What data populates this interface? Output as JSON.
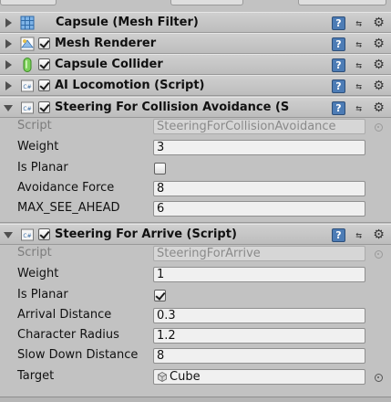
{
  "components": [
    {
      "title": "Capsule (Mesh Filter)",
      "icon": "mesh-filter-icon",
      "has_checkbox": false,
      "expanded": false
    },
    {
      "title": "Mesh Renderer",
      "icon": "mesh-renderer-icon",
      "has_checkbox": true,
      "checked": true,
      "expanded": false
    },
    {
      "title": "Capsule Collider",
      "icon": "capsule-collider-icon",
      "has_checkbox": true,
      "checked": true,
      "expanded": false
    },
    {
      "title": "AI Locomotion (Script)",
      "icon": "script-icon",
      "has_checkbox": true,
      "checked": true,
      "expanded": false
    },
    {
      "title": "Steering For Collision Avoidance (S",
      "icon": "script-icon",
      "has_checkbox": true,
      "checked": true,
      "expanded": true
    },
    {
      "title": "Steering For Arrive (Script)",
      "icon": "script-icon",
      "has_checkbox": true,
      "checked": true,
      "expanded": true
    }
  ],
  "header_icons": {
    "help": "?",
    "preset": "preset-icon",
    "gear": "gear-icon"
  },
  "collision_avoidance": {
    "script_label": "Script",
    "script_value": "SteeringForCollisionAvoidance",
    "weight_label": "Weight",
    "weight_value": "3",
    "is_planar_label": "Is Planar",
    "is_planar_checked": false,
    "avoidance_force_label": "Avoidance Force",
    "avoidance_force_value": "8",
    "max_see_ahead_label": "MAX_SEE_AHEAD",
    "max_see_ahead_value": "6"
  },
  "arrive": {
    "script_label": "Script",
    "script_value": "SteeringForArrive",
    "weight_label": "Weight",
    "weight_value": "1",
    "is_planar_label": "Is Planar",
    "is_planar_checked": true,
    "arrival_distance_label": "Arrival Distance",
    "arrival_distance_value": "0.3",
    "character_radius_label": "Character Radius",
    "character_radius_value": "1.2",
    "slow_down_distance_label": "Slow Down Distance",
    "slow_down_distance_value": "8",
    "target_label": "Target",
    "target_value": "Cube"
  }
}
